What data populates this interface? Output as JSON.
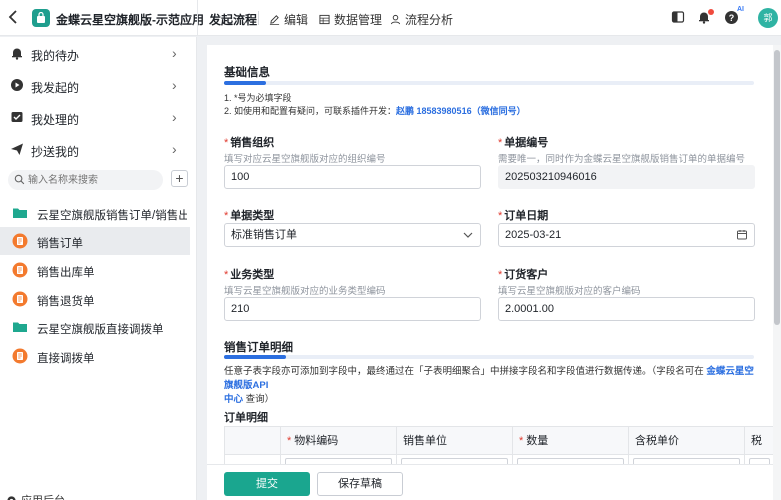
{
  "header": {
    "app_title": "金蝶云星空旗舰版-示范应用",
    "tabs": [
      {
        "label": "发起流程"
      },
      {
        "label": "编辑"
      },
      {
        "label": "数据管理"
      },
      {
        "label": "流程分析"
      }
    ],
    "ai_badge": "AI",
    "avatar_text": "郭"
  },
  "sidebar": {
    "nav": [
      {
        "label": "我的待办"
      },
      {
        "label": "我发起的"
      },
      {
        "label": "我处理的"
      },
      {
        "label": "抄送我的"
      }
    ],
    "search_placeholder": "输入名称来搜索",
    "add_label": "+",
    "tree": [
      {
        "label": "云星空旗舰版销售订单/销售出...",
        "icon": "folder-icon"
      },
      {
        "label": "销售订单",
        "icon": "form-icon",
        "selected": true
      },
      {
        "label": "销售出库单",
        "icon": "form-icon"
      },
      {
        "label": "销售退货单",
        "icon": "form-icon"
      },
      {
        "label": "云星空旗舰版直接调拨单",
        "icon": "folder-icon"
      },
      {
        "label": "直接调拨单",
        "icon": "form-icon"
      }
    ],
    "bottom_label": "应用后台"
  },
  "form": {
    "basic_title": "基础信息",
    "note1": "1. *号为必填字段",
    "note2_prefix": "2. 如使用和配置有疑问，可联系插件开发：",
    "note2_contact": "赵鹏 18583980516（微信同号）",
    "fields": {
      "sales_org": {
        "label": "销售组织",
        "hint": "填写对应云星空旗舰版对应的组织编号",
        "value": "100"
      },
      "bill_no": {
        "label": "单据编号",
        "hint": "需要唯一，同时作为金蝶云星空旗舰版销售订单的单据编号",
        "value": "202503210946016"
      },
      "bill_type": {
        "label": "单据类型",
        "value": "标准销售订单"
      },
      "order_date": {
        "label": "订单日期",
        "value": "2025-03-21"
      },
      "biz_type": {
        "label": "业务类型",
        "hint": "填写云星空旗舰版对应的业务类型编码",
        "value": "210"
      },
      "customer": {
        "label": "订货客户",
        "hint": "填写云星空旗舰版对应的客户编码",
        "value": "2.0001.00"
      }
    },
    "detail_title": "销售订单明细",
    "detail_desc_prefix": "任意子表字段亦可添加到字段中，最终通过在「子表明细聚合」中拼接字段名和字段值进行数据传递。（字段名可在 ",
    "detail_desc_link1": "金蝶云星空旗舰版API",
    "detail_desc_link2": "中心",
    "detail_desc_suffix": " 查询）",
    "table_title": "订单明细",
    "table_headers": [
      "",
      "物料编码",
      "销售单位",
      "数量",
      "含税单价",
      "税"
    ]
  },
  "footer": {
    "submit_label": "提交",
    "draft_label": "保存草稿"
  },
  "colors": {
    "primary": "#1aa68f",
    "link": "#2c6fe0",
    "required": "#e03b2f"
  }
}
